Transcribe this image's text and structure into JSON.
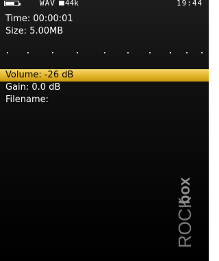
{
  "status": {
    "codec": "WAV",
    "frequency": "44k",
    "clock": "19:44",
    "battery_level": 0.6
  },
  "recording": {
    "time_label": "Time: 00:00:01",
    "size_label": "Size: 5.00MB"
  },
  "menu": {
    "items": [
      {
        "label": "Volume: -26 dB",
        "selected": true
      },
      {
        "label": "Gain:  0.0 dB",
        "selected": false
      },
      {
        "label": "Filename:",
        "selected": false
      }
    ]
  },
  "logo": {
    "text": "ROCKbox",
    "icon": "rockbox-logo-watermark"
  },
  "colors": {
    "selection": "#e3b52a",
    "background": "#000000",
    "text": "#ffffff"
  }
}
